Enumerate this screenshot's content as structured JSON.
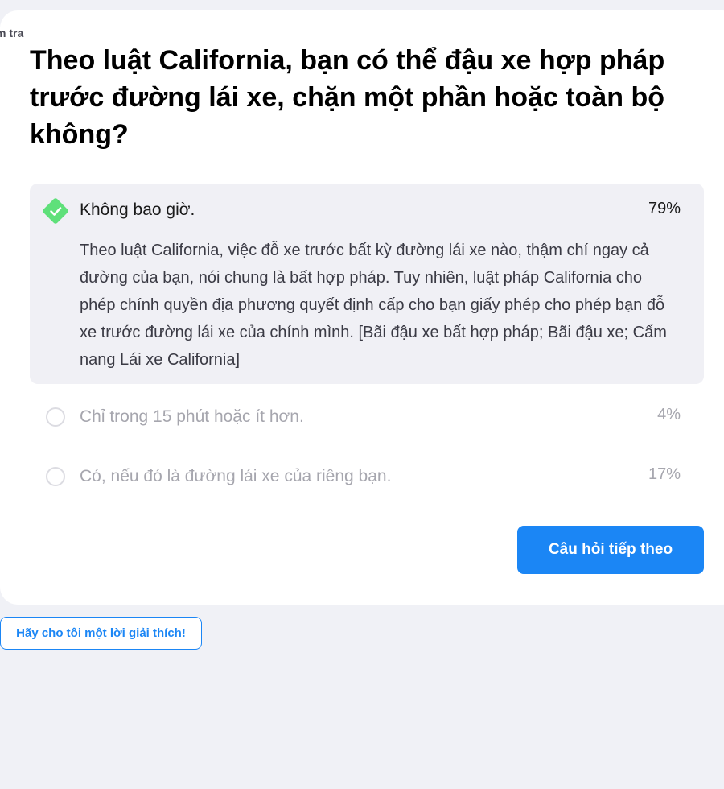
{
  "breadcrumb": "m tra",
  "question": "Theo luật California, bạn có thể đậu xe hợp pháp trước đường lái xe, chặn một phần hoặc toàn bộ không?",
  "answers": [
    {
      "label": "Không bao giờ.",
      "percent": "79%",
      "correct": true,
      "icon": "check-diamond-icon",
      "explanation": "Theo luật California, việc đỗ xe trước bất kỳ đường lái xe nào, thậm chí ngay cả đường của bạn, nói chung là bất hợp pháp. Tuy nhiên, luật pháp California cho phép chính quyền địa phương quyết định cấp cho bạn giấy phép cho phép bạn đỗ xe trước đường lái xe của chính mình. [Bãi đậu xe bất hợp pháp; Bãi đậu xe; Cẩm nang Lái xe California]"
    },
    {
      "label": "Chỉ trong 15 phút hoặc ít hơn.",
      "percent": "4%",
      "correct": false
    },
    {
      "label": "Có, nếu đó là đường lái xe của riêng bạn.",
      "percent": "17%",
      "correct": false
    }
  ],
  "buttons": {
    "next": "Câu hỏi tiếp theo",
    "explain": "Hãy cho tôi một lời giải thích!"
  },
  "colors": {
    "accent": "#1b86f5",
    "correct": "#5fe07a",
    "background": "#f0f1f6"
  }
}
